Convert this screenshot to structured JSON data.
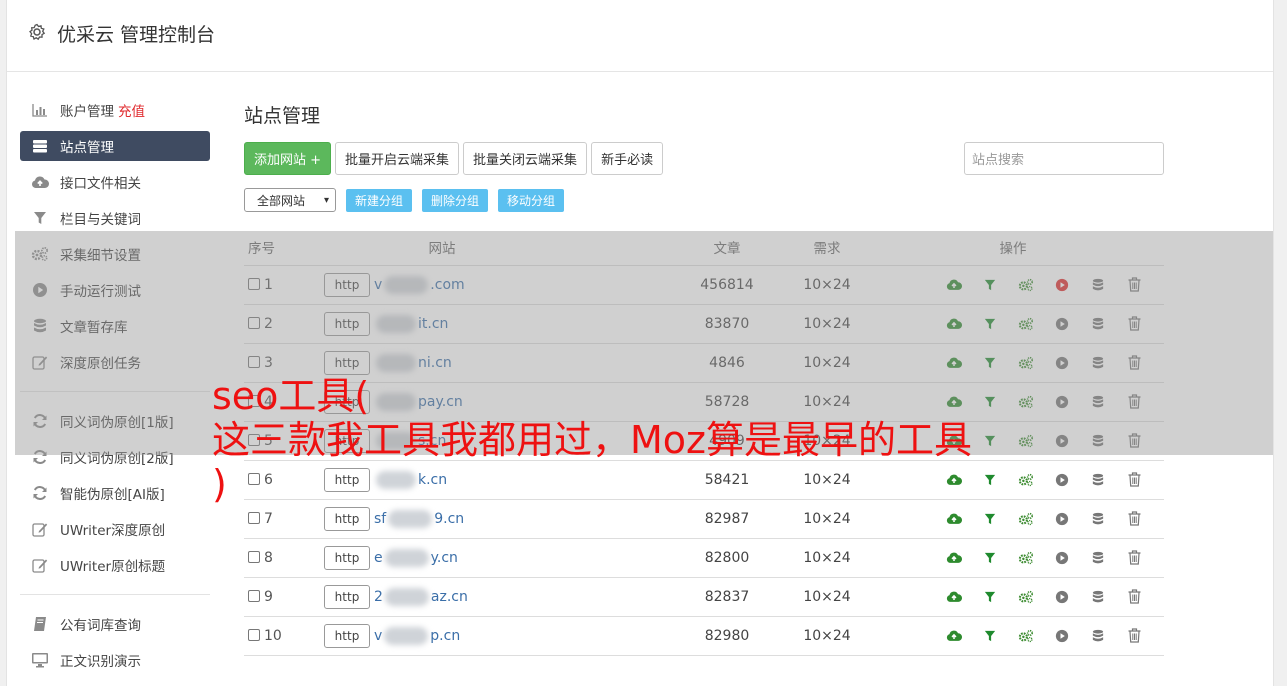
{
  "app": {
    "title": "优采云 管理控制台"
  },
  "sidebar": {
    "group1": [
      {
        "label": "账户管理",
        "extra": "充值",
        "icon": "bar-chart-icon"
      },
      {
        "label": "站点管理",
        "icon": "server-icon",
        "active": true
      },
      {
        "label": "接口文件相关",
        "icon": "cloud-upload-icon"
      },
      {
        "label": "栏目与关键词",
        "icon": "filter-icon"
      },
      {
        "label": "采集细节设置",
        "icon": "gears-icon"
      },
      {
        "label": "手动运行测试",
        "icon": "play-icon"
      },
      {
        "label": "文章暂存库",
        "icon": "database-icon"
      },
      {
        "label": "深度原创任务",
        "icon": "edit-icon"
      }
    ],
    "group2": [
      {
        "label": "同义词伪原创[1版]",
        "icon": "refresh-icon"
      },
      {
        "label": "同义词伪原创[2版]",
        "icon": "refresh-icon"
      },
      {
        "label": "智能伪原创[AI版]",
        "icon": "refresh-icon"
      },
      {
        "label": "UWriter深度原创",
        "icon": "edit-icon"
      },
      {
        "label": "UWriter原创标题",
        "icon": "edit-icon"
      }
    ],
    "group3": [
      {
        "label": "公有词库查询",
        "icon": "book-icon"
      },
      {
        "label": "正文识别演示",
        "icon": "monitor-icon"
      }
    ]
  },
  "main": {
    "title": "站点管理",
    "toolbar": {
      "add": "添加网站 +",
      "batch_open": "批量开启云端采集",
      "batch_close": "批量关闭云端采集",
      "newbie": "新手必读",
      "search_placeholder": "站点搜索"
    },
    "group_bar": {
      "select": "全部网站",
      "new_group": "新建分组",
      "delete_group": "删除分组",
      "move_group": "移动分组"
    },
    "table": {
      "headers": {
        "no": "序号",
        "site": "网站",
        "articles": "文章",
        "demand": "需求",
        "ops": "操作"
      },
      "rows": [
        {
          "no": "1",
          "protocol": "http",
          "pre": "v",
          "suffix": ".com",
          "articles": "456814",
          "demand": "10×24",
          "run_active": true
        },
        {
          "no": "2",
          "protocol": "http",
          "pre": "",
          "suffix": "it.cn",
          "articles": "83870",
          "demand": "10×24",
          "run_active": false
        },
        {
          "no": "3",
          "protocol": "http",
          "pre": "",
          "suffix": "ni.cn",
          "articles": "4846",
          "demand": "10×24",
          "run_active": false
        },
        {
          "no": "4",
          "protocol": "http",
          "pre": "",
          "suffix": "pay.cn",
          "articles": "58728",
          "demand": "10×24",
          "run_active": false
        },
        {
          "no": "5",
          "protocol": "http",
          "pre": "",
          "suffix": "s.cn",
          "articles": "4909",
          "demand": "10×24",
          "run_active": false
        },
        {
          "no": "6",
          "protocol": "http",
          "pre": "",
          "suffix": "k.cn",
          "articles": "58421",
          "demand": "10×24",
          "run_active": false
        },
        {
          "no": "7",
          "protocol": "http",
          "pre": "sf",
          "suffix": "9.cn",
          "articles": "82987",
          "demand": "10×24",
          "run_active": false
        },
        {
          "no": "8",
          "protocol": "http",
          "pre": "e",
          "suffix": "y.cn",
          "articles": "82800",
          "demand": "10×24",
          "run_active": false
        },
        {
          "no": "9",
          "protocol": "http",
          "pre": "2",
          "suffix": "az.cn",
          "articles": "82837",
          "demand": "10×24",
          "run_active": false
        },
        {
          "no": "10",
          "protocol": "http",
          "pre": "v",
          "suffix": "p.cn",
          "articles": "82980",
          "demand": "10×24",
          "run_active": false
        }
      ]
    }
  },
  "caption": "seo工具(\n这三款我工具我都用过，Moz算是最早的工具\n)",
  "colors": {
    "accent_green": "#5cb85c",
    "nav_active": "#3f4b61",
    "link_blue": "#3a6ea8",
    "caption_red": "#ee1111"
  }
}
